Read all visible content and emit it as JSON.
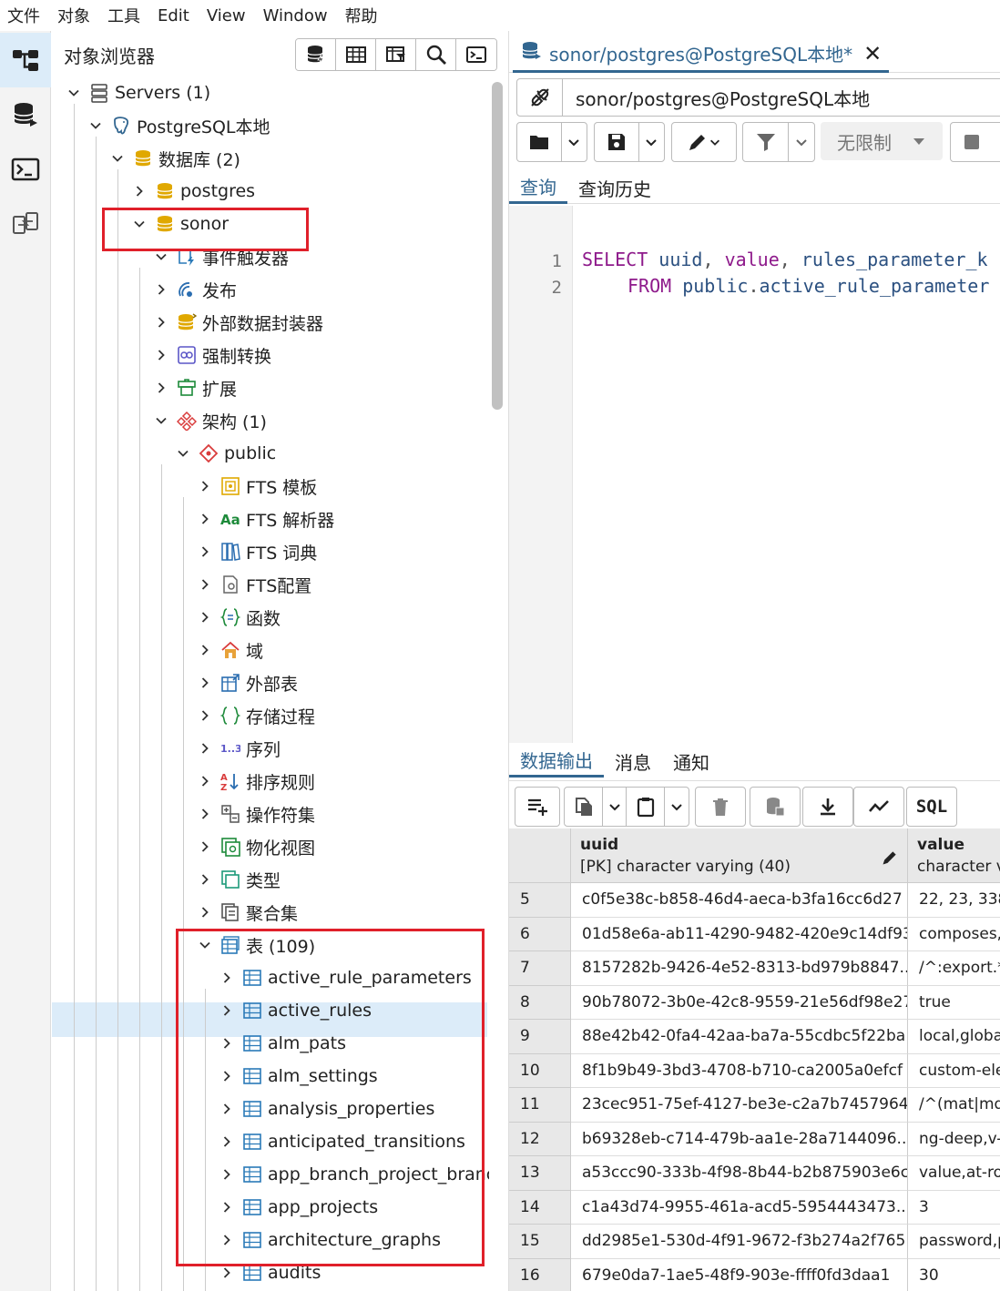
{
  "menubar": [
    "文件",
    "对象",
    "工具",
    "Edit",
    "View",
    "Window",
    "帮助"
  ],
  "browser": {
    "title": "对象浏览器",
    "tree": [
      {
        "label": "Servers (1)",
        "chev": "down",
        "icon": "servers-icon"
      },
      {
        "label": "PostgreSQL本地",
        "chev": "down",
        "icon": "postgres-elephant-icon"
      },
      {
        "label": "数据库 (2)",
        "chev": "down",
        "icon": "databases-icon"
      },
      {
        "label": "postgres",
        "chev": "right",
        "icon": "database-icon"
      },
      {
        "label": "sonor",
        "chev": "down",
        "icon": "database-icon"
      },
      {
        "label": "事件触发器",
        "chev": "down",
        "icon": "event-trigger-icon"
      },
      {
        "label": "发布",
        "chev": "right",
        "icon": "publication-icon"
      },
      {
        "label": "外部数据封装器",
        "chev": "right",
        "icon": "foreign-data-wrapper-icon"
      },
      {
        "label": "强制转换",
        "chev": "right",
        "icon": "cast-icon"
      },
      {
        "label": "扩展",
        "chev": "right",
        "icon": "extension-icon"
      },
      {
        "label": "架构 (1)",
        "chev": "down",
        "icon": "schemas-icon"
      },
      {
        "label": "public",
        "chev": "down",
        "icon": "schema-icon"
      },
      {
        "label": "FTS 模板",
        "chev": "right",
        "icon": "fts-template-icon"
      },
      {
        "label": "FTS 解析器",
        "chev": "right",
        "icon": "fts-parser-icon"
      },
      {
        "label": "FTS 词典",
        "chev": "right",
        "icon": "fts-dictionary-icon"
      },
      {
        "label": "FTS配置",
        "chev": "right",
        "icon": "fts-config-icon"
      },
      {
        "label": "函数",
        "chev": "right",
        "icon": "function-icon"
      },
      {
        "label": "域",
        "chev": "right",
        "icon": "domain-icon"
      },
      {
        "label": "外部表",
        "chev": "right",
        "icon": "foreign-table-icon"
      },
      {
        "label": "存储过程",
        "chev": "right",
        "icon": "procedure-icon"
      },
      {
        "label": "序列",
        "chev": "right",
        "icon": "sequence-icon"
      },
      {
        "label": "排序规则",
        "chev": "right",
        "icon": "collation-icon"
      },
      {
        "label": "操作符集",
        "chev": "right",
        "icon": "operator-icon"
      },
      {
        "label": "物化视图",
        "chev": "right",
        "icon": "materialized-view-icon"
      },
      {
        "label": "类型",
        "chev": "right",
        "icon": "type-icon"
      },
      {
        "label": "聚合集",
        "chev": "right",
        "icon": "aggregate-icon"
      },
      {
        "label": "表 (109)",
        "chev": "down",
        "icon": "tables-icon"
      },
      {
        "label": "active_rule_parameters",
        "chev": "right",
        "icon": "table-icon"
      },
      {
        "label": "active_rules",
        "chev": "right",
        "icon": "table-icon"
      },
      {
        "label": "alm_pats",
        "chev": "right",
        "icon": "table-icon"
      },
      {
        "label": "alm_settings",
        "chev": "right",
        "icon": "table-icon"
      },
      {
        "label": "analysis_properties",
        "chev": "right",
        "icon": "table-icon"
      },
      {
        "label": "anticipated_transitions",
        "chev": "right",
        "icon": "table-icon"
      },
      {
        "label": "app_branch_project_branch",
        "chev": "right",
        "icon": "table-icon"
      },
      {
        "label": "app_projects",
        "chev": "right",
        "icon": "table-icon"
      },
      {
        "label": "architecture_graphs",
        "chev": "right",
        "icon": "table-icon"
      },
      {
        "label": "audits",
        "chev": "right",
        "icon": "table-icon"
      }
    ]
  },
  "editor": {
    "tab_title": "sonor/postgres@PostgreSQL本地*",
    "connection": "sonor/postgres@PostgreSQL本地",
    "limit_label": "无限制",
    "query_tabs": [
      "查询",
      "查询历史"
    ],
    "line_numbers": [
      "1",
      "2"
    ],
    "line1": {
      "kw": "SELECT",
      "a": "uuid",
      "b": "value",
      "c": "rules_parameter_k"
    },
    "line2": {
      "kw": "FROM",
      "schema": "public",
      "table": "active_rule_parameter"
    }
  },
  "results": {
    "tabs": [
      "数据输出",
      "消息",
      "通知"
    ],
    "sql_label": "SQL",
    "columns": [
      {
        "name": "uuid",
        "type": "[PK] character varying (40)"
      },
      {
        "name": "value",
        "type": "character v"
      }
    ],
    "rows": [
      {
        "idx": "5",
        "uuid": "c0f5e38c-b858-46d4-aeca-b3fa16cc6d27",
        "value": "22, 23, 338"
      },
      {
        "idx": "6",
        "uuid": "01d58e6a-ab11-4290-9482-420e9c14df93",
        "value": "composes,"
      },
      {
        "idx": "7",
        "uuid": "8157282b-9426-4e52-8313-bd979b8847...",
        "value": "/^:export.*/"
      },
      {
        "idx": "8",
        "uuid": "90b78072-3b0e-42c8-9559-21e56df98e27",
        "value": "true"
      },
      {
        "idx": "9",
        "uuid": "88e42b42-0fa4-42aa-ba7a-55cdbc5f22ba",
        "value": "local,globa"
      },
      {
        "idx": "10",
        "uuid": "8f1b9b49-3bd3-4708-b710-ca2005a0efcf",
        "value": "custom-ele"
      },
      {
        "idx": "11",
        "uuid": "23cec951-75ef-4127-be3e-c2a7b7457964",
        "value": "/^(mat|md|"
      },
      {
        "idx": "12",
        "uuid": "b69328eb-c714-479b-aa1e-28a7144096...",
        "value": "ng-deep,v-c"
      },
      {
        "idx": "13",
        "uuid": "a53ccc90-333b-4f98-8b44-b2b875903e6c",
        "value": "value,at-ro"
      },
      {
        "idx": "14",
        "uuid": "c1a43d74-9955-461a-acd5-5954443473...",
        "value": "3"
      },
      {
        "idx": "15",
        "uuid": "dd2985e1-530d-4f91-9672-f3b274a2f765",
        "value": "password,p"
      },
      {
        "idx": "16",
        "uuid": "679e0da7-1ae5-48f9-903e-ffff0fd3daa1",
        "value": "30"
      }
    ]
  },
  "colors": {
    "accent": "#326690",
    "selected": "#dcecf9",
    "annotation": "#e0202a",
    "db_gold": "#e0a800"
  }
}
